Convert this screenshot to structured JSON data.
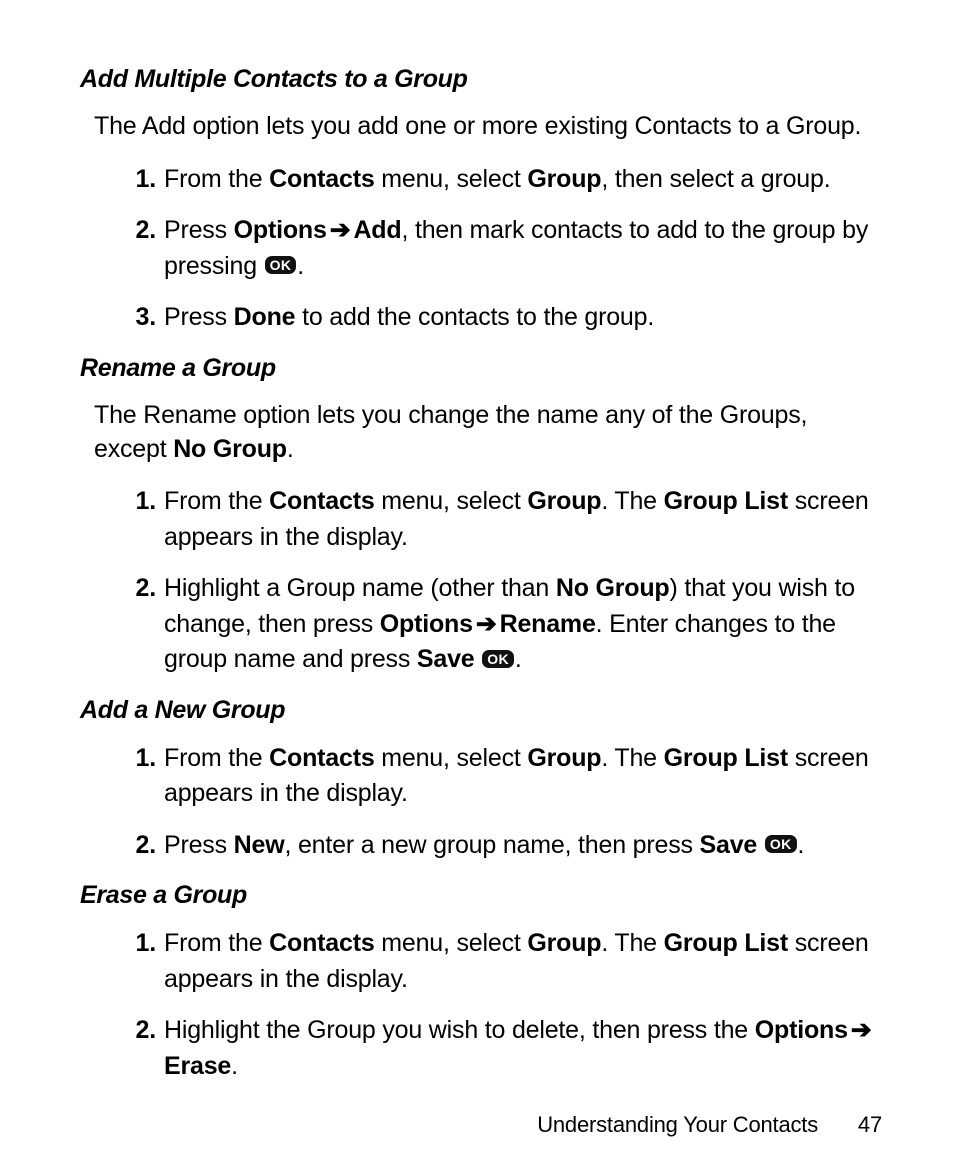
{
  "icons": {
    "ok_label": "OK",
    "arrow": "➔"
  },
  "footer": {
    "title": "Understanding Your Contacts",
    "page_number": "47"
  },
  "sections": [
    {
      "id": "add-multiple",
      "heading": "Add Multiple Contacts to a Group",
      "intro_parts": [
        "The Add option lets you add one or more existing Contacts to a Group."
      ],
      "steps": [
        [
          {
            "t": "From the "
          },
          {
            "t": "Contacts",
            "bold": true
          },
          {
            "t": " menu, select "
          },
          {
            "t": "Group",
            "bold": true
          },
          {
            "t": ", then select a group."
          }
        ],
        [
          {
            "t": "Press "
          },
          {
            "t": "Options",
            "bold": true
          },
          {
            "arrow": true
          },
          {
            "t": "Add",
            "bold": true
          },
          {
            "t": ", then mark contacts to add to the group by pressing "
          },
          {
            "ok": true
          },
          {
            "t": "."
          }
        ],
        [
          {
            "t": "Press "
          },
          {
            "t": "Done",
            "bold": true
          },
          {
            "t": " to add the contacts to the group."
          }
        ]
      ]
    },
    {
      "id": "rename",
      "heading": "Rename a Group",
      "intro_parts": [
        "The Rename option lets you change the name any of the Groups, except ",
        {
          "t": "No Group",
          "bold": true
        },
        "."
      ],
      "steps": [
        [
          {
            "t": "From the "
          },
          {
            "t": "Contacts",
            "bold": true
          },
          {
            "t": " menu, select "
          },
          {
            "t": "Group",
            "bold": true
          },
          {
            "t": ". The "
          },
          {
            "t": "Group List",
            "bold": true
          },
          {
            "t": " screen appears in the display."
          }
        ],
        [
          {
            "t": "Highlight a Group name (other than "
          },
          {
            "t": "No Group",
            "bold": true
          },
          {
            "t": ") that you wish to change, then press "
          },
          {
            "t": "Options",
            "bold": true
          },
          {
            "arrow": true
          },
          {
            "t": "Rename",
            "bold": true
          },
          {
            "t": ".   Enter changes to the group name and press "
          },
          {
            "t": "Save",
            "bold": true
          },
          {
            "t": " "
          },
          {
            "ok": true
          },
          {
            "t": "."
          }
        ]
      ]
    },
    {
      "id": "add-new",
      "heading": "Add a New Group",
      "intro_parts": null,
      "steps": [
        [
          {
            "t": "From the "
          },
          {
            "t": "Contacts",
            "bold": true
          },
          {
            "t": " menu, select "
          },
          {
            "t": "Group",
            "bold": true
          },
          {
            "t": ". The "
          },
          {
            "t": "Group List",
            "bold": true
          },
          {
            "t": " screen appears in the display."
          }
        ],
        [
          {
            "t": "Press "
          },
          {
            "t": "New",
            "bold": true
          },
          {
            "t": ", enter a new group name, then press "
          },
          {
            "t": "Save",
            "bold": true
          },
          {
            "t": " "
          },
          {
            "ok": true
          },
          {
            "t": "."
          }
        ]
      ]
    },
    {
      "id": "erase",
      "heading": "Erase a Group",
      "intro_parts": null,
      "steps": [
        [
          {
            "t": "From the "
          },
          {
            "t": "Contacts",
            "bold": true
          },
          {
            "t": " menu, select "
          },
          {
            "t": "Group",
            "bold": true
          },
          {
            "t": ". The "
          },
          {
            "t": "Group List",
            "bold": true
          },
          {
            "t": " screen appears in the display."
          }
        ],
        [
          {
            "t": "Highlight the Group you wish to delete, then press the "
          },
          {
            "t": "Options",
            "bold": true
          },
          {
            "arrow": true
          },
          {
            "t": "Erase",
            "bold": true
          },
          {
            "t": "."
          }
        ]
      ]
    }
  ]
}
